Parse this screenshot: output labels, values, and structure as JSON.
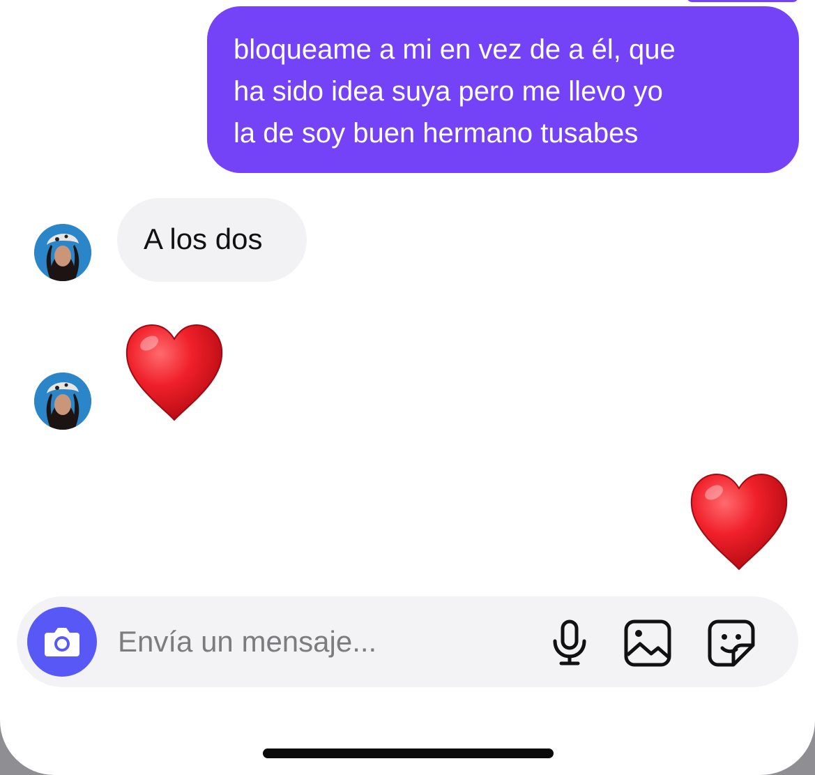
{
  "messages": [
    {
      "direction": "sent",
      "type": "text",
      "lines": [
        "bloqueame a mi en vez de a él, que",
        "ha sido idea suya pero me llevo yo",
        "la de soy buen hermano tusabes"
      ]
    },
    {
      "direction": "received",
      "type": "text",
      "text": "A los dos"
    },
    {
      "direction": "received",
      "type": "emoji",
      "emoji": "red-heart"
    },
    {
      "direction": "sent",
      "type": "emoji",
      "emoji": "red-heart"
    }
  ],
  "composer": {
    "placeholder": "Envía un mensaje...",
    "icons": [
      "camera-icon",
      "microphone-icon",
      "gallery-icon",
      "sticker-icon"
    ]
  },
  "colors": {
    "sent_bubble": "#7443f8",
    "received_bubble": "#f2f2f4",
    "camera_button": "#5758f6",
    "heart": "#e0161e"
  }
}
